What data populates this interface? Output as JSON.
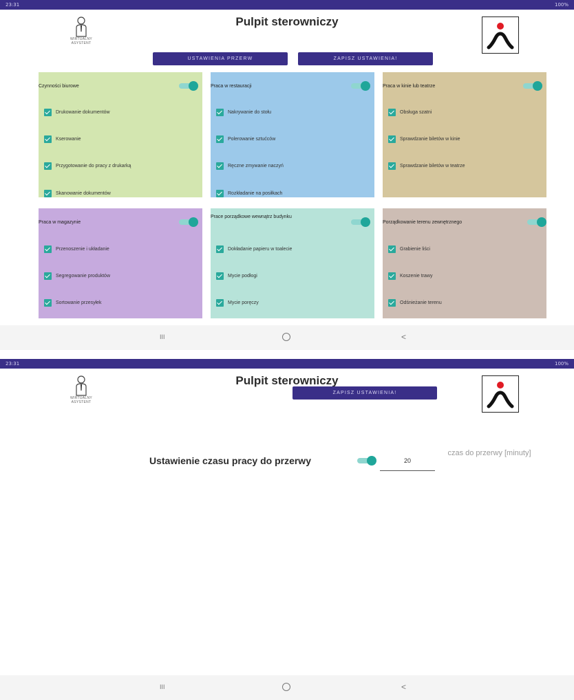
{
  "colors": {
    "statusbar": "#3a2f88",
    "button": "#3a2f88",
    "toggle_on": "#1fa69a",
    "checkbox": "#2aa99c",
    "green": "#d3e6b0",
    "blue": "#9cc9ea",
    "tan": "#d5c69d",
    "purple": "#c6aade",
    "teal": "#b7e3d9",
    "taupe": "#cdbdb4"
  },
  "statusbar": {
    "time": "23:31",
    "battery": "100%"
  },
  "app": {
    "title": "Pulpit sterowniczy",
    "logo_caption_1": "WIRTUALNY",
    "logo_caption_2": "ASYSTENT"
  },
  "screen1": {
    "btn_break": "USTAWIENIA PRZERW",
    "btn_save": "ZAPISZ USTAWIENIA!",
    "categories": [
      {
        "label": "Czynności biurowe",
        "enabled": true,
        "items": [
          "Drukowanie dokumentów",
          "Kserowanie",
          "Przygotowanie do pracy z drukarką",
          "Skanowanie dokumentów"
        ]
      },
      {
        "label": "Praca w restauracji",
        "enabled": true,
        "items": [
          "Nakrywanie do stołu",
          "Polerowanie sztućców",
          "Ręczne zmywanie naczyń",
          "Rozkładanie na posiłkach"
        ]
      },
      {
        "label": "Praca w kinie lub teatrze",
        "enabled": true,
        "items": [
          "Obsługa szatni",
          "Sprawdzanie biletów w kinie",
          "Sprawdzanie biletów w teatrze"
        ]
      },
      {
        "label": "Praca w magazynie",
        "enabled": true,
        "items": [
          "Przenoszenie i układanie",
          "Segregowanie produktów",
          "Sortowanie przesyłek"
        ]
      },
      {
        "label": "Prace porządkowe wewnątrz budynku",
        "enabled": true,
        "items": [
          "Dokładanie papieru w toalecie",
          "Mycie podłogi",
          "Mycie poręczy"
        ]
      },
      {
        "label": "Porządkowanie terenu zewnętrznego",
        "enabled": true,
        "items": [
          "Grabienie liści",
          "Koszenie trawy",
          "Odśnieżanie terenu"
        ]
      }
    ]
  },
  "screen2": {
    "btn_save": "ZAPISZ USTAWIENIA!",
    "setting_label": "Ustawienie czasu pracy do przerwy",
    "setting_enabled": true,
    "minutes_value": "20",
    "hint": "czas do przerwy [minuty]"
  },
  "navbar": {
    "recents": "III",
    "home": "",
    "back": "<"
  }
}
